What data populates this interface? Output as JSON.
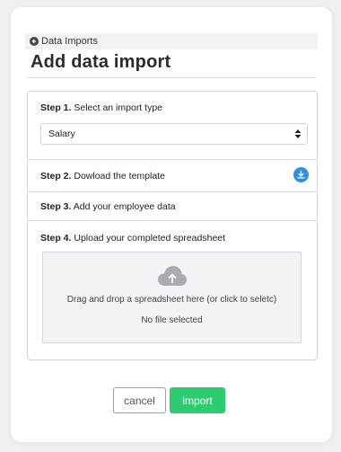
{
  "breadcrumb": {
    "label": "Data Imports"
  },
  "page": {
    "title": "Add data import"
  },
  "steps": [
    {
      "number": "Step 1.",
      "text": "Select an import type"
    },
    {
      "number": "Step 2.",
      "text": "Dowload the template"
    },
    {
      "number": "Step 3.",
      "text": "Add your employee data"
    },
    {
      "number": "Step 4.",
      "text": "Upload your completed spreadsheet"
    }
  ],
  "import_type": {
    "selected": "Salary"
  },
  "dropzone": {
    "instruction": "Drag and drop a spreadsheet here (or click to seletc)",
    "status": "No file selected"
  },
  "actions": {
    "cancel_label": "cancel",
    "import_label": "import"
  },
  "colors": {
    "accent_blue": "#2f8ee5",
    "import_green": "#2ecc71"
  },
  "icons": {
    "back": "arrow-left-circle-icon",
    "caret": "sort-caret-icon",
    "download": "download-icon",
    "upload": "cloud-upload-icon"
  }
}
